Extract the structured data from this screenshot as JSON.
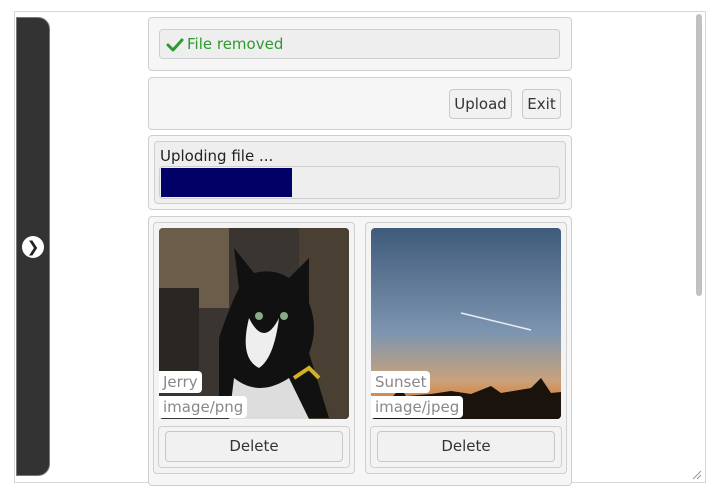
{
  "status": {
    "message": "File removed",
    "icon": "check-icon"
  },
  "toolbar": {
    "upload_label": "Upload",
    "exit_label": "Exit"
  },
  "upload": {
    "label": "Uploding file ...",
    "progress": 0.33,
    "bar_color": "#000066"
  },
  "files": [
    {
      "name": "Jerry",
      "type": "image/png",
      "delete_label": "Delete"
    },
    {
      "name": "Sunset",
      "type": "image/jpeg",
      "delete_label": "Delete"
    }
  ],
  "drawer": {
    "toggle_icon": "chevron-right-icon"
  }
}
